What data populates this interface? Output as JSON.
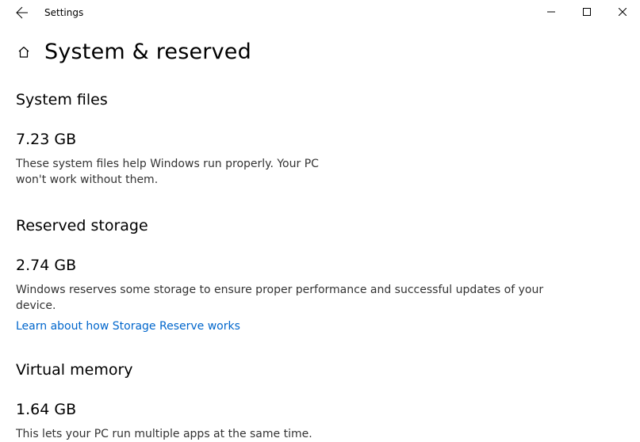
{
  "titlebar": {
    "app_name": "Settings"
  },
  "header": {
    "title": "System & reserved"
  },
  "sections": {
    "system_files": {
      "title": "System files",
      "value": "7.23 GB",
      "description": "These system files help Windows run properly. Your PC won't work without them."
    },
    "reserved_storage": {
      "title": "Reserved storage",
      "value": "2.74 GB",
      "description": "Windows reserves some storage to ensure proper performance and successful updates of your device.",
      "link_label": "Learn about how Storage Reserve works"
    },
    "virtual_memory": {
      "title": "Virtual memory",
      "value": "1.64 GB",
      "description": "This lets your PC run multiple apps at the same time."
    }
  }
}
